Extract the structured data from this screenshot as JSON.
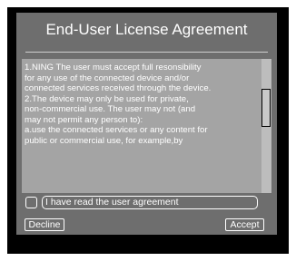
{
  "dialog": {
    "title": "End-User License Agreement",
    "eula_lines": [
      "1.NING The user must accept full resonsibility",
      "for any use of the connected device and/or",
      "connected services received through the device.",
      "2.The device may only be used for private,",
      "non-commercial use. The user may not (and",
      "may not permit any person to):",
      "a.use the connected services or any content for",
      "public or commercial use, for example,by"
    ],
    "checkbox_label": "I have read the user agreement",
    "decline_label": "Decline",
    "accept_label": "Accept"
  },
  "colors": {
    "dialog_background": "#6e6e6e",
    "text_panel": "#a4a4a4",
    "frame": "#000000"
  }
}
